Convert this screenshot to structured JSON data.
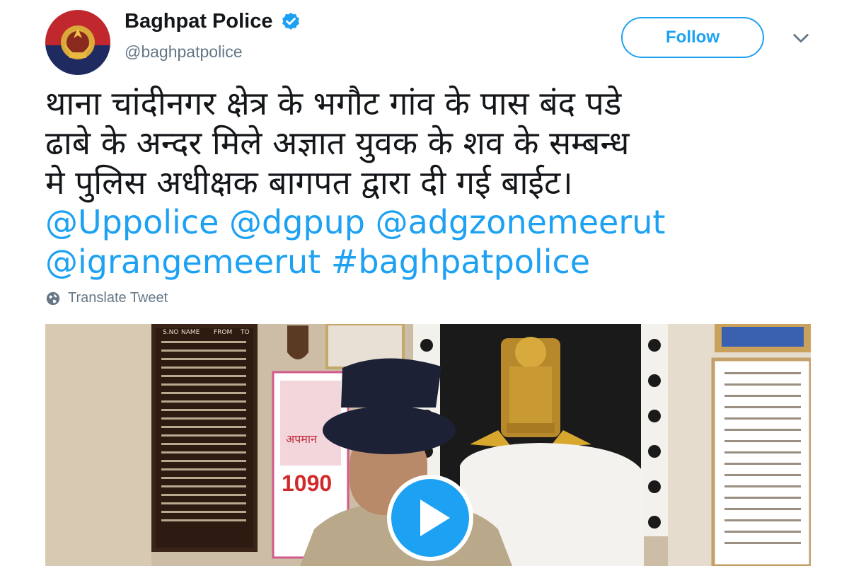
{
  "profile": {
    "name": "Baghpat Police",
    "handle": "@baghpatpolice",
    "verified_icon": "verified-badge-icon"
  },
  "actions": {
    "follow_label": "Follow",
    "more_icon": "chevron-down-icon"
  },
  "tweet": {
    "line1": "थाना चांदीनगर क्षेत्र के भगौट गांव के पास बंद पडे",
    "line2": "ढाबे के अन्दर मिले अज्ञात युवक के शव के सम्बन्ध",
    "line3": "मे पुलिस अधीक्षक बागपत द्वारा दी गई बाईट।",
    "mention1": "@Uppolice",
    "mention2": "@dgpup",
    "mention3": "@adgzonemeerut",
    "mention4": "@igrangemeerut",
    "hashtag": "#baghpatpolice"
  },
  "translate_label": "Translate Tweet",
  "media": {
    "type": "video",
    "play_icon": "play-icon",
    "board": {
      "col_name": "NAME",
      "col_from": "FROM",
      "col_to": "TO",
      "col_sno": "S.NO"
    },
    "poster": {
      "title": "अपमान",
      "number": "1090"
    }
  },
  "colors": {
    "accent": "#1da1f2",
    "text": "#14171a",
    "muted": "#657786"
  }
}
